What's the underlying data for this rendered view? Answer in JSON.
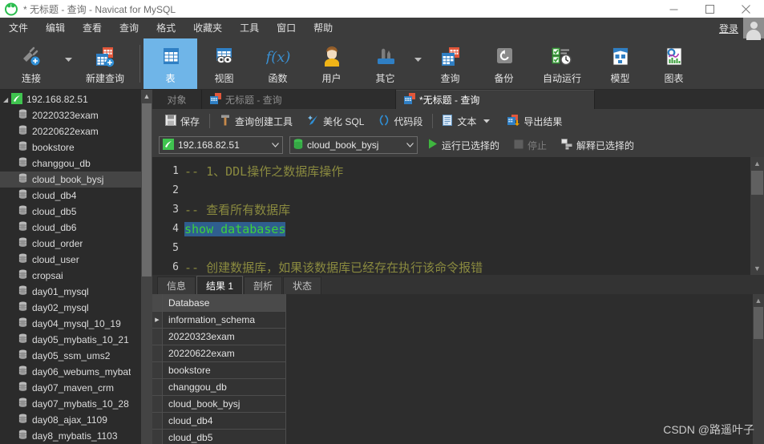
{
  "window": {
    "title": "* 无标题 - 查询 - Navicat for MySQL",
    "logo_icon": "navicat-logo-icon",
    "minimize_icon": "minimize-icon",
    "maximize_icon": "maximize-icon",
    "close_icon": "close-icon"
  },
  "menubar": {
    "items": [
      {
        "label": "文件",
        "name": "menu-file"
      },
      {
        "label": "编辑",
        "name": "menu-edit"
      },
      {
        "label": "查看",
        "name": "menu-view"
      },
      {
        "label": "查询",
        "name": "menu-query"
      },
      {
        "label": "格式",
        "name": "menu-format"
      },
      {
        "label": "收藏夹",
        "name": "menu-favorites"
      },
      {
        "label": "工具",
        "name": "menu-tools"
      },
      {
        "label": "窗口",
        "name": "menu-window"
      },
      {
        "label": "帮助",
        "name": "menu-help"
      }
    ],
    "login_label": "登录",
    "avatar_icon": "user-avatar-icon"
  },
  "toolbar": {
    "items": [
      {
        "label": "连接",
        "icon": "connection-icon",
        "name": "toolbar-connection",
        "selected": false,
        "caret": true
      },
      {
        "label": "新建查询",
        "icon": "new-query-icon",
        "name": "toolbar-new-query",
        "selected": false,
        "caret": false
      },
      {
        "label": "表",
        "icon": "table-icon",
        "name": "toolbar-table",
        "selected": true,
        "caret": false
      },
      {
        "label": "视图",
        "icon": "view-icon",
        "name": "toolbar-view",
        "selected": false,
        "caret": false
      },
      {
        "label": "函数",
        "icon": "function-icon",
        "name": "toolbar-function",
        "selected": false,
        "caret": false
      },
      {
        "label": "用户",
        "icon": "user-icon",
        "name": "toolbar-user",
        "selected": false,
        "caret": false
      },
      {
        "label": "其它",
        "icon": "other-tools-icon",
        "name": "toolbar-other",
        "selected": false,
        "caret": true
      },
      {
        "label": "查询",
        "icon": "query-icon",
        "name": "toolbar-query",
        "selected": false,
        "caret": false
      },
      {
        "label": "备份",
        "icon": "backup-icon",
        "name": "toolbar-backup",
        "selected": false,
        "caret": false
      },
      {
        "label": "自动运行",
        "icon": "automation-icon",
        "name": "toolbar-automation",
        "selected": false,
        "caret": false
      },
      {
        "label": "模型",
        "icon": "model-icon",
        "name": "toolbar-model",
        "selected": false,
        "caret": false
      },
      {
        "label": "图表",
        "icon": "chart-icon",
        "name": "toolbar-chart",
        "selected": false,
        "caret": false
      }
    ]
  },
  "sidebar": {
    "root": {
      "label": "192.168.82.51",
      "icon": "mysql-connection-icon"
    },
    "databases": [
      {
        "label": "20220323exam",
        "selected": false
      },
      {
        "label": "20220622exam",
        "selected": false
      },
      {
        "label": "bookstore",
        "selected": false
      },
      {
        "label": "changgou_db",
        "selected": false
      },
      {
        "label": "cloud_book_bysj",
        "selected": true
      },
      {
        "label": "cloud_db4",
        "selected": false
      },
      {
        "label": "cloud_db5",
        "selected": false
      },
      {
        "label": "cloud_db6",
        "selected": false
      },
      {
        "label": "cloud_order",
        "selected": false
      },
      {
        "label": "cloud_user",
        "selected": false
      },
      {
        "label": "cropsai",
        "selected": false
      },
      {
        "label": "day01_mysql",
        "selected": false
      },
      {
        "label": "day02_mysql",
        "selected": false
      },
      {
        "label": "day04_mysql_10_19",
        "selected": false
      },
      {
        "label": "day05_mybatis_10_21",
        "selected": false
      },
      {
        "label": "day05_ssm_ums2",
        "selected": false
      },
      {
        "label": "day06_webums_mybat",
        "selected": false
      },
      {
        "label": "day07_maven_crm",
        "selected": false
      },
      {
        "label": "day07_mybatis_10_28",
        "selected": false
      },
      {
        "label": "day08_ajax_1109",
        "selected": false
      },
      {
        "label": "day8_mybatis_1103",
        "selected": false
      }
    ]
  },
  "tabs": [
    {
      "label": "对象",
      "active": false,
      "icon": null,
      "name": "tab-objects"
    },
    {
      "label": "无标题 - 查询",
      "active": false,
      "icon": "query-tab-icon",
      "name": "tab-untitled-query-1"
    },
    {
      "label": "*无标题 - 查询",
      "active": true,
      "icon": "query-tab-icon",
      "name": "tab-untitled-query-2"
    }
  ],
  "query_toolbar": {
    "save_label": "保存",
    "save_icon": "save-icon",
    "query_builder_label": "查询创建工具",
    "query_builder_icon": "hammer-icon",
    "beautify_label": "美化 SQL",
    "beautify_icon": "wand-icon",
    "snippet_label": "代码段",
    "snippet_icon": "parentheses-icon",
    "text_label": "文本",
    "text_icon": "document-icon",
    "text_caret": "chevron-down-icon",
    "export_label": "导出结果",
    "export_icon": "export-results-icon"
  },
  "connection_bar": {
    "connection_value": "192.168.82.51",
    "connection_icon": "mysql-connection-icon",
    "database_value": "cloud_book_bysj",
    "database_icon": "database-icon",
    "run_label": "运行已选择的",
    "run_icon": "play-icon",
    "stop_label": "停止",
    "stop_icon": "stop-icon",
    "explain_label": "解释已选择的",
    "explain_icon": "explain-icon"
  },
  "editor": {
    "line_numbers": [
      "1",
      "2",
      "3",
      "4",
      "5",
      "6"
    ],
    "lines": [
      {
        "num": "1",
        "segments": [
          {
            "text": "-- 1、DDL操作之数据库操作",
            "style": "cmt"
          }
        ]
      },
      {
        "num": "2",
        "segments": []
      },
      {
        "num": "3",
        "segments": [
          {
            "text": "-- 查看所有数据库",
            "style": "cmt"
          }
        ]
      },
      {
        "num": "4",
        "segments": [
          {
            "text": "show databases",
            "style": "kw"
          }
        ]
      },
      {
        "num": "5",
        "segments": []
      },
      {
        "num": "6",
        "segments": [
          {
            "text": "-- 创建数据库，如果该数据库已经存在执行该命令报错",
            "style": "cmt"
          }
        ]
      }
    ]
  },
  "result_tabs": [
    {
      "label": "信息",
      "active": false,
      "name": "result-tab-info"
    },
    {
      "label": "结果 1",
      "active": true,
      "name": "result-tab-result1"
    },
    {
      "label": "剖析",
      "active": false,
      "name": "result-tab-profile"
    },
    {
      "label": "状态",
      "active": false,
      "name": "result-tab-status"
    }
  ],
  "result_grid": {
    "columns": [
      "Database"
    ],
    "rows": [
      [
        "information_schema"
      ],
      [
        "20220323exam"
      ],
      [
        "20220622exam"
      ],
      [
        "bookstore"
      ],
      [
        "changgou_db"
      ],
      [
        "cloud_book_bysj"
      ],
      [
        "cloud_db4"
      ],
      [
        "cloud_db5"
      ]
    ],
    "current_row_index": 0,
    "current_row_marker": "▶"
  },
  "watermark": "CSDN @路遥叶子",
  "colors": {
    "accent_blue": "#6fb5e8",
    "toolbar_bg": "#3c3c3c",
    "editor_bg": "#2b2b2b",
    "comment": "#8a8a3f",
    "keyword": "#3dd13d",
    "selection": "#2f5e8f",
    "run_green": "#3fb63f"
  }
}
